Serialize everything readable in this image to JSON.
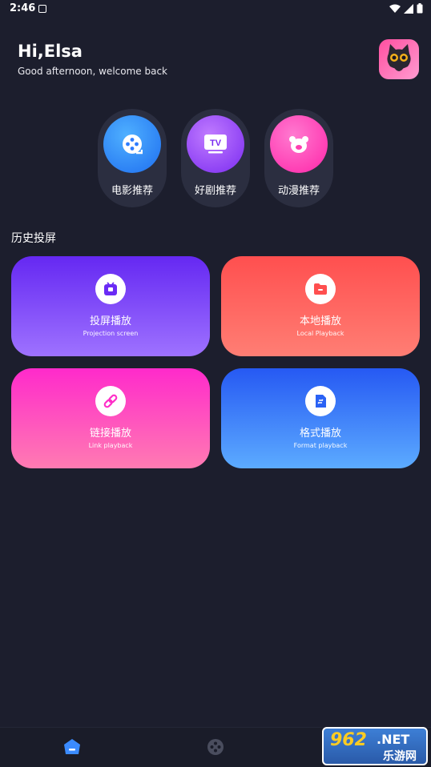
{
  "status_bar": {
    "time": "2:46"
  },
  "header": {
    "greeting": "Hi,Elsa",
    "subtitle": "Good afternoon, welcome back"
  },
  "recommendations": [
    {
      "label": "电影推荐",
      "icon": "film-reel-icon",
      "color": "#3a8dff"
    },
    {
      "label": "好剧推荐",
      "icon": "tv-icon",
      "color": "#9b4dff"
    },
    {
      "label": "动漫推荐",
      "icon": "bear-icon",
      "color": "#ff3fb0"
    }
  ],
  "section": {
    "title": "历史投屏"
  },
  "cards": [
    {
      "title": "投屏播放",
      "subtitle": "Projection screen",
      "icon": "cast-tv-icon",
      "colors": [
        "#6a2bf5",
        "#9a6cff"
      ]
    },
    {
      "title": "本地播放",
      "subtitle": "Local Playback",
      "icon": "folder-icon",
      "colors": [
        "#ff5252",
        "#ff7a72"
      ]
    },
    {
      "title": "链接播放",
      "subtitle": "Link playback",
      "icon": "link-icon",
      "colors": [
        "#ff2ec8",
        "#ff78b8"
      ]
    },
    {
      "title": "格式播放",
      "subtitle": "Format playback",
      "icon": "format-icon",
      "colors": [
        "#2a62f5",
        "#5aa8ff"
      ]
    }
  ],
  "bottom_nav": [
    {
      "name": "home",
      "icon": "home-icon",
      "active": true
    },
    {
      "name": "film",
      "icon": "film-icon",
      "active": false
    }
  ],
  "watermark": {
    "big": "962",
    "net": ".NET",
    "cn": "乐游网"
  }
}
